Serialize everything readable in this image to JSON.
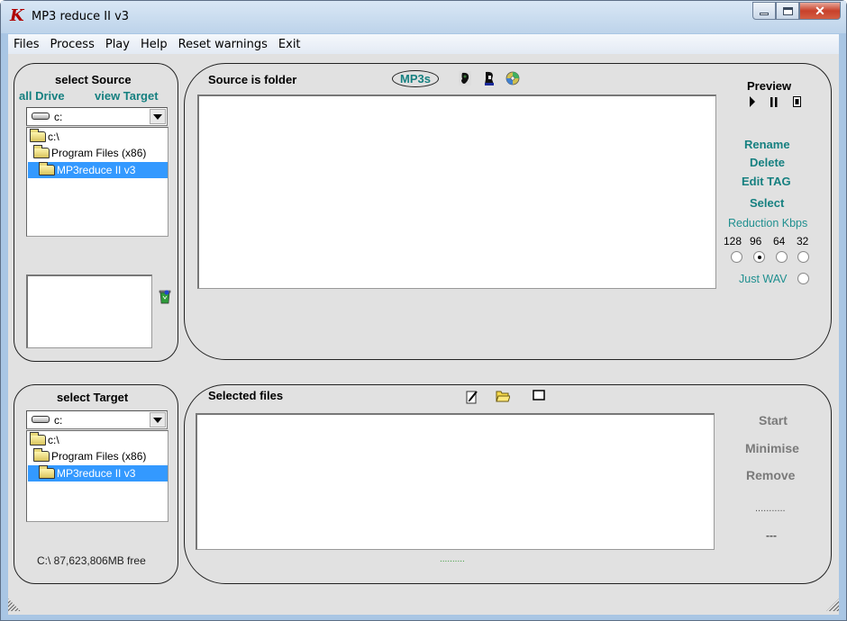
{
  "window": {
    "title": "MP3 reduce II v3",
    "controls": [
      "minimize",
      "maximize",
      "close"
    ]
  },
  "menu": [
    "Files",
    "Process",
    "Play",
    "Help",
    "Reset warnings",
    "Exit"
  ],
  "source_panel": {
    "heading": "select Source",
    "all_drive_link": "all Drive",
    "view_target_link": "view Target",
    "drive": "c:",
    "folders": [
      "c:\\",
      "Program Files (x86)",
      "MP3reduce II v3"
    ],
    "selected_folder": "MP3reduce II v3",
    "recycle_icon": "recycle-bin-icon"
  },
  "source_files": {
    "heading": "Source is folder",
    "filter_label": "MP3s",
    "icons": [
      "ear-icon",
      "person-icon",
      "cd-icon"
    ]
  },
  "actions": {
    "preview_label": "Preview",
    "preview_controls": [
      "play-icon",
      "pause-icon",
      "stop-icon"
    ],
    "rename": "Rename",
    "delete": "Delete",
    "edit_tag": "Edit TAG",
    "select": "Select",
    "reduction_label": "Reduction Kbps",
    "bitrates": [
      "128",
      "96",
      "64",
      "32"
    ],
    "selected_bitrate": "96",
    "just_wav_label": "Just WAV",
    "just_wav_checked": false
  },
  "target_panel": {
    "heading": "select Target",
    "drive": "c:",
    "folders": [
      "c:\\",
      "Program Files (x86)",
      "MP3reduce II v3"
    ],
    "selected_folder": "MP3reduce II v3",
    "free_space": "C:\\  87,623,806MB free"
  },
  "selected_files": {
    "heading": "Selected files",
    "icons": [
      "edit-list-icon",
      "open-folder-icon",
      "blank-square-icon"
    ],
    "status_dots": "..........",
    "colors": {
      "status_dots": "#3a9a3a"
    }
  },
  "process": {
    "start": "Start",
    "minimise": "Minimise",
    "remove": "Remove",
    "progress_dots": "...........",
    "progress_dash": "---"
  },
  "colors": {
    "accent_teal": "#168080",
    "disabled_grey": "#7a7a7a",
    "selection_blue": "#3399ff",
    "client_bg": "#e1e1e1"
  }
}
